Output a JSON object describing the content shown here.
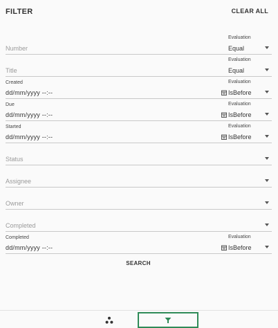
{
  "header": {
    "title": "FILTER",
    "clear_label": "CLEAR ALL"
  },
  "fields": [
    {
      "label": "Number",
      "type": "text",
      "evaluation_label": "Evaluation",
      "evaluation_value": "Equal"
    },
    {
      "label": "Title",
      "type": "text",
      "evaluation_label": "Evaluation",
      "evaluation_value": "Equal"
    },
    {
      "label": "Created",
      "type": "date",
      "value": "dd/mm/yyyy --:--",
      "evaluation_label": "Evaluation",
      "evaluation_value": "IsBefore"
    },
    {
      "label": "Due",
      "type": "date",
      "value": "dd/mm/yyyy --:--",
      "evaluation_label": "Evaluation",
      "evaluation_value": "IsBefore"
    },
    {
      "label": "Started",
      "type": "date",
      "value": "dd/mm/yyyy --:--",
      "evaluation_label": "Evaluation",
      "evaluation_value": "IsBefore"
    },
    {
      "label": "Status",
      "type": "select"
    },
    {
      "label": "Assignee",
      "type": "select"
    },
    {
      "label": "Owner",
      "type": "select"
    },
    {
      "label": "Completed",
      "type": "select"
    },
    {
      "label": "Completed",
      "type": "date",
      "value": "dd/mm/yyyy --:--",
      "evaluation_label": "Evaluation",
      "evaluation_value": "IsBefore"
    }
  ],
  "search_label": "SEARCH",
  "bottom_nav": [
    {
      "icon": "three-dots-icon",
      "active": false
    },
    {
      "icon": "filter-icon",
      "active": true
    }
  ],
  "colors": {
    "accent": "#2e8b57",
    "divider": "#c8c8c8"
  }
}
